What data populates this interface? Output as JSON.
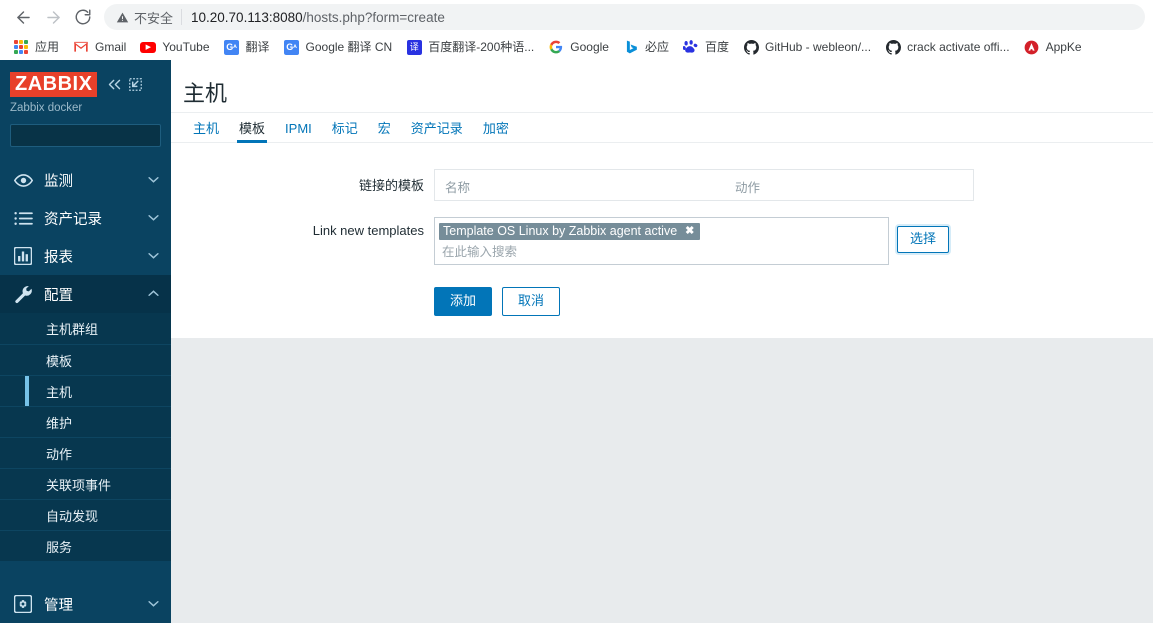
{
  "browser": {
    "nav": {
      "back": "back-arrow",
      "forward": "forward-arrow",
      "reload": "reload"
    },
    "omnibox": {
      "security_label": "不安全",
      "url_host": "10.20.70.113:8080",
      "url_path": "/hosts.php?form=create",
      "full_url": "10.20.70.113:8080/hosts.php?form=create"
    },
    "bookmarks": [
      {
        "label": "应用",
        "icon": "apps-grid-icon"
      },
      {
        "label": "Gmail",
        "icon": "gmail-icon"
      },
      {
        "label": "YouTube",
        "icon": "youtube-icon"
      },
      {
        "label": "翻译",
        "icon": "google-translate-icon"
      },
      {
        "label": "Google 翻译 CN",
        "icon": "google-translate-icon"
      },
      {
        "label": "百度翻译-200种语...",
        "icon": "baidu-translate-icon",
        "glyph": "译"
      },
      {
        "label": "Google",
        "icon": "google-icon",
        "glyph": "G"
      },
      {
        "label": "必应",
        "icon": "bing-icon",
        "glyph": "b"
      },
      {
        "label": "百度",
        "icon": "baidu-icon",
        "glyph": "🐾"
      },
      {
        "label": "GitHub - webleon/...",
        "icon": "github-icon"
      },
      {
        "label": "crack activate offi...",
        "icon": "github-icon"
      },
      {
        "label": "AppKe",
        "icon": "appke-icon"
      }
    ]
  },
  "sidebar": {
    "logo_text": "ZABBIX",
    "server_name": "Zabbix docker",
    "collapse_icon": "chevron-double-left-icon",
    "hide_icon": "collapse-sidebar-icon",
    "search_placeholder": "",
    "search_value": "",
    "menu": [
      {
        "label": "监测",
        "icon": "eye-icon",
        "arrow": "chevron-down",
        "expanded": false
      },
      {
        "label": "资产记录",
        "icon": "list-icon",
        "arrow": "chevron-down",
        "expanded": false
      },
      {
        "label": "报表",
        "icon": "bar-chart-icon",
        "arrow": "chevron-down",
        "expanded": false
      },
      {
        "label": "配置",
        "icon": "wrench-icon",
        "arrow": "chevron-up",
        "expanded": true
      }
    ],
    "config_submenu": [
      {
        "label": "主机群组",
        "selected": false
      },
      {
        "label": "模板",
        "selected": false
      },
      {
        "label": "主机",
        "selected": true
      },
      {
        "label": "维护",
        "selected": false
      },
      {
        "label": "动作",
        "selected": false
      },
      {
        "label": "关联项事件",
        "selected": false
      },
      {
        "label": "自动发现",
        "selected": false
      },
      {
        "label": "服务",
        "selected": false
      }
    ],
    "bottom_menu": [
      {
        "label": "管理",
        "icon": "gear-icon",
        "arrow": "chevron-down"
      }
    ]
  },
  "main": {
    "page_title": "主机",
    "tabs": [
      {
        "label": "主机",
        "active": false
      },
      {
        "label": "模板",
        "active": true
      },
      {
        "label": "IPMI",
        "active": false
      },
      {
        "label": "标记",
        "active": false
      },
      {
        "label": "宏",
        "active": false
      },
      {
        "label": "资产记录",
        "active": false
      },
      {
        "label": "加密",
        "active": false
      }
    ],
    "form": {
      "linked_templates": {
        "label": "链接的模板",
        "col_name": "名称",
        "col_action": "动作"
      },
      "link_new_templates": {
        "label": "Link new templates",
        "token": "Template OS Linux by Zabbix agent active",
        "token_remove_icon": "close-icon",
        "input_placeholder": "在此输入搜索",
        "input_value": "",
        "select_button": "选择"
      },
      "actions": {
        "submit": "添加",
        "cancel": "取消"
      }
    }
  },
  "colors": {
    "accent": "#0275b8",
    "sidebar_bg": "#0a4361",
    "sidebar_active": "#063249",
    "logo_red": "#e8402a",
    "token_bg": "#768d99",
    "page_bg": "#e8ebed"
  }
}
